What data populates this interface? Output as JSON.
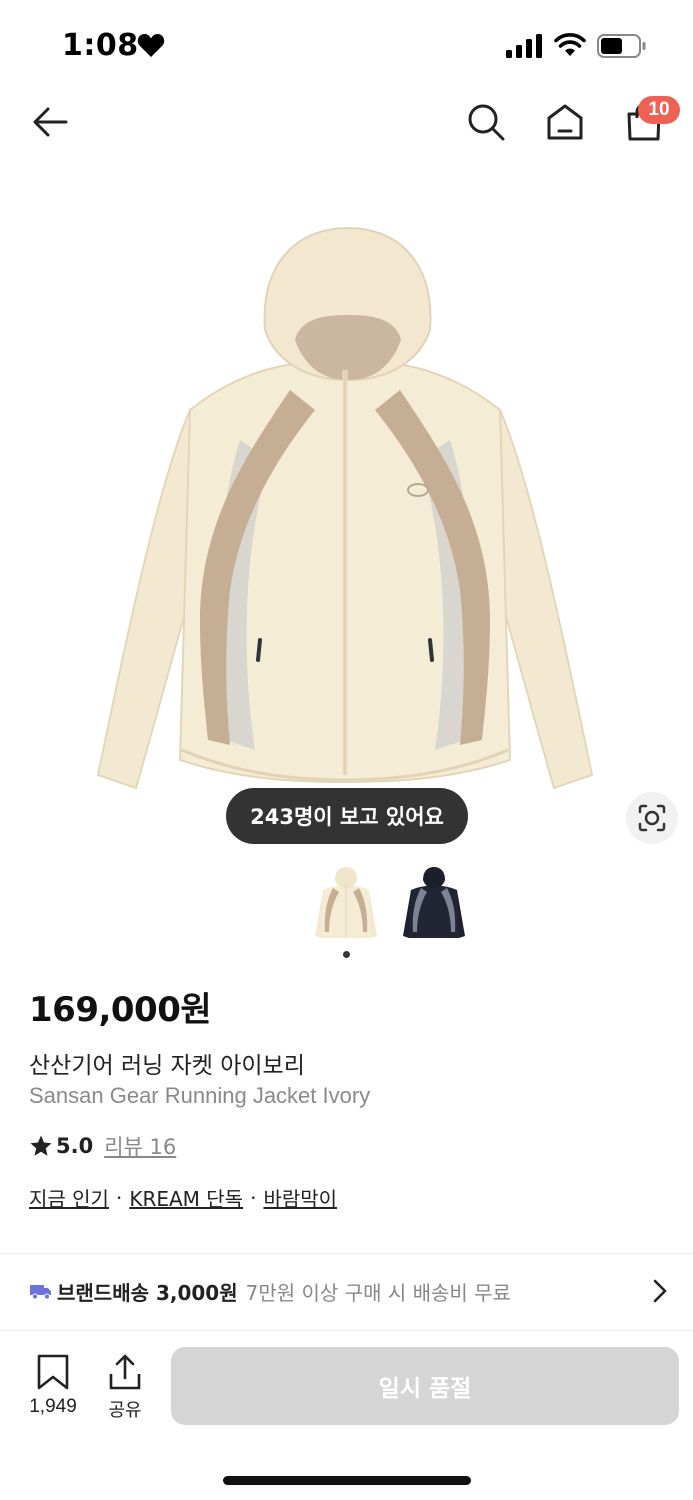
{
  "status_bar": {
    "time": "1:08"
  },
  "nav": {
    "cart_count": "10"
  },
  "gallery": {
    "viewers_text": "243명이 보고 있어요"
  },
  "product": {
    "price": "169,000원",
    "name_ko": "산산기어 러닝 자켓 아이보리",
    "name_en": "Sansan Gear Running Jacket Ivory",
    "rating": "5.0",
    "review_text": "리뷰 16",
    "tags": [
      "지금 인기",
      "KREAM 단독",
      "바람막이"
    ]
  },
  "shipping": {
    "main": "브랜드배송 3,000원",
    "sub": "7만원 이상 구매 시 배송비 무료"
  },
  "bottom_bar": {
    "bookmark_count": "1,949",
    "share_label": "공유",
    "soldout_label": "일시 품절"
  },
  "colors": {
    "badge": "#ef6253",
    "truck": "#6b72e0",
    "jacket_ivory": "#f4ead2",
    "jacket_panel": "#c4ad93",
    "button_disabled": "#d5d5d5"
  },
  "icons": [
    "heart-icon",
    "signal-icon",
    "wifi-icon",
    "battery-icon",
    "back-arrow-icon",
    "search-icon",
    "home-icon",
    "shopping-bag-icon",
    "lens-search-icon",
    "star-icon",
    "truck-icon",
    "chevron-right-icon",
    "bookmark-icon",
    "share-icon"
  ]
}
